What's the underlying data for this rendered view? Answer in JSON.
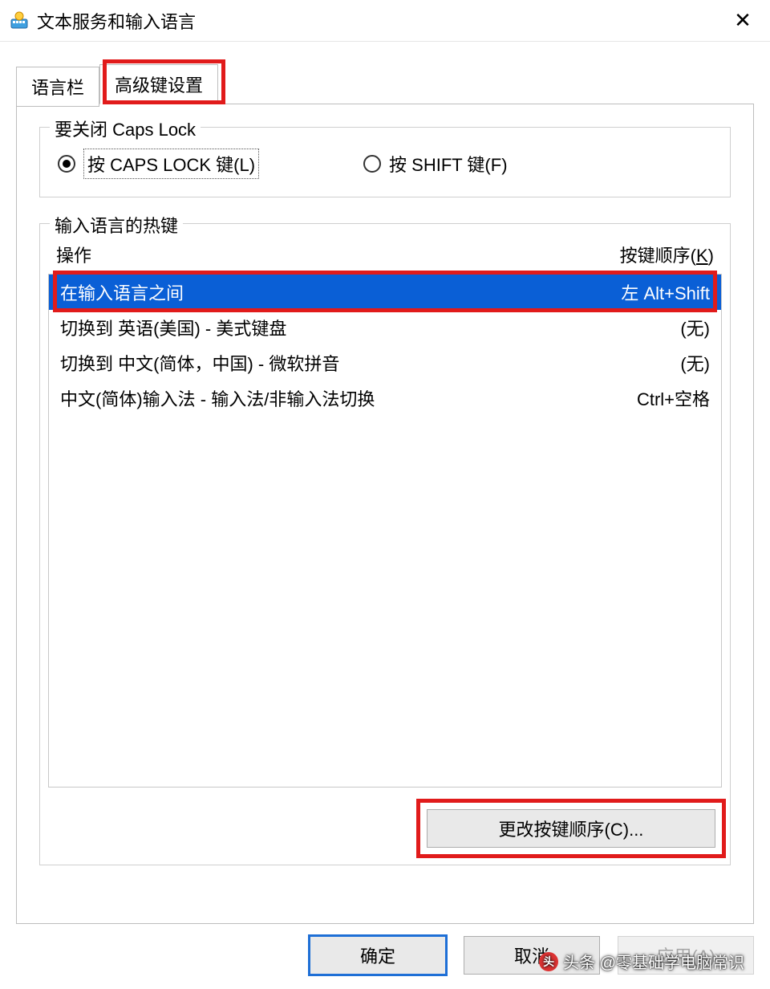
{
  "window": {
    "title": "文本服务和输入语言",
    "close_glyph": "✕"
  },
  "tabs": {
    "language_bar": "语言栏",
    "advanced": "高级键设置"
  },
  "capslock": {
    "legend": "要关闭 Caps Lock",
    "opt_caps": "按 CAPS LOCK 键(L)",
    "opt_shift": "按 SHIFT 键(F)"
  },
  "hotkeys": {
    "legend": "输入语言的热键",
    "col_action": "操作",
    "col_seq_prefix": "按键顺序(",
    "col_seq_key": "K",
    "col_seq_suffix": ")",
    "rows": [
      {
        "action": "在输入语言之间",
        "seq": "左 Alt+Shift",
        "selected": true
      },
      {
        "action": "切换到 英语(美国) - 美式键盘",
        "seq": "(无)",
        "selected": false
      },
      {
        "action": "切换到 中文(简体，中国) - 微软拼音",
        "seq": "(无)",
        "selected": false
      },
      {
        "action": "中文(简体)输入法 - 输入法/非输入法切换",
        "seq": "Ctrl+空格",
        "selected": false
      }
    ],
    "change_btn": "更改按键顺序(C)..."
  },
  "buttons": {
    "ok": "确定",
    "cancel": "取消",
    "apply": "应用(A)"
  },
  "watermark": {
    "badge": "头",
    "text": "头条 @零基础学电脑常识"
  }
}
